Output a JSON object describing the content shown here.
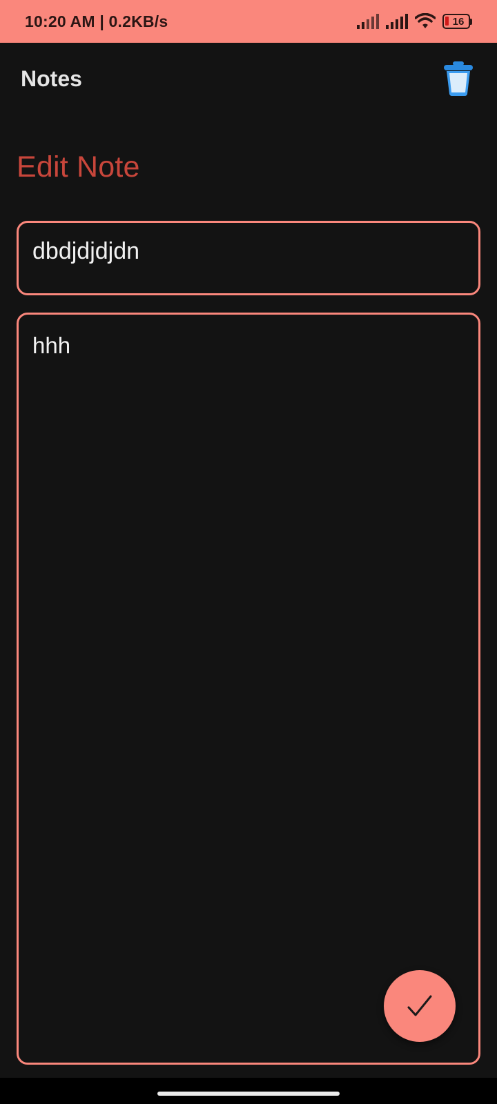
{
  "status_bar": {
    "time_speed": "10:20 AM | 0.2KB/s",
    "battery_level": "16",
    "icons": [
      "signal-icon",
      "signal-icon",
      "wifi-icon",
      "battery-icon"
    ]
  },
  "app_bar": {
    "title": "Notes",
    "delete_icon": "trash-can-icon"
  },
  "screen": {
    "heading": "Edit Note"
  },
  "note": {
    "title_value": "dbdjdjdjdn",
    "body_value": "hhh"
  },
  "fab": {
    "icon": "check-icon"
  },
  "colors": {
    "accent": "#fa877c",
    "heading": "#c8463b",
    "background": "#131313",
    "text": "#f2f2f2"
  }
}
